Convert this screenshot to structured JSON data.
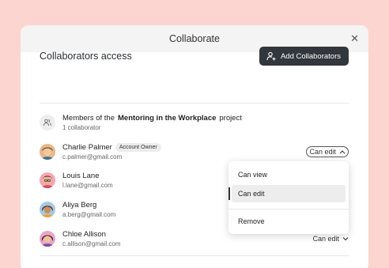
{
  "modal": {
    "title": "Collaborate",
    "close_icon": "close-icon"
  },
  "access": {
    "title": "Collaborators access",
    "add_button_label": "Add Collaborators",
    "add_button_icon": "add-person-icon"
  },
  "project_members": {
    "prefix": "Members of the",
    "project_name": "Mentoring in the Workplace",
    "suffix": "project",
    "count_label": "1 collaborator",
    "icon": "group-icon"
  },
  "collaborators": [
    {
      "name": "Charlie Palmer",
      "email": "c.palmer@gmail.com",
      "badge": "Account Owner",
      "role": "Can edit",
      "dropdown_open": true
    },
    {
      "name": "Louis Lane",
      "email": "l.lane@gmail.com"
    },
    {
      "name": "Aliya Berg",
      "email": "a.berg@gmail.com"
    },
    {
      "name": "Chloe Allison",
      "email": "c.allison@gmail.com",
      "role": "Can edit"
    }
  ],
  "role_menu": {
    "options": [
      "Can view",
      "Can edit"
    ],
    "selected": "Can edit",
    "remove_label": "Remove"
  },
  "colors": {
    "background": "#fcd5d1",
    "button": "#31373d",
    "header": "#f4f4f4"
  }
}
